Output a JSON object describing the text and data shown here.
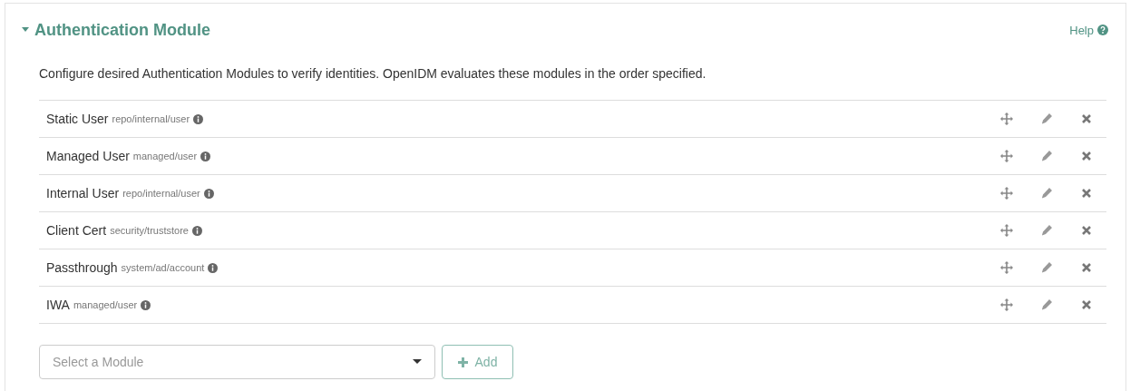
{
  "panel": {
    "title": "Authentication Module",
    "expanded": true,
    "help": "Help"
  },
  "description": "Configure desired Authentication Modules to verify identities. OpenIDM evaluates these modules in the order specified.",
  "modules": [
    {
      "name": "Static User",
      "path": "repo/internal/user"
    },
    {
      "name": "Managed User",
      "path": "managed/user"
    },
    {
      "name": "Internal User",
      "path": "repo/internal/user"
    },
    {
      "name": "Client Cert",
      "path": "security/truststore"
    },
    {
      "name": "Passthrough",
      "path": "system/ad/account"
    },
    {
      "name": "IWA",
      "path": "managed/user"
    }
  ],
  "select": {
    "placeholder": "Select a Module"
  },
  "add_button": "Add"
}
